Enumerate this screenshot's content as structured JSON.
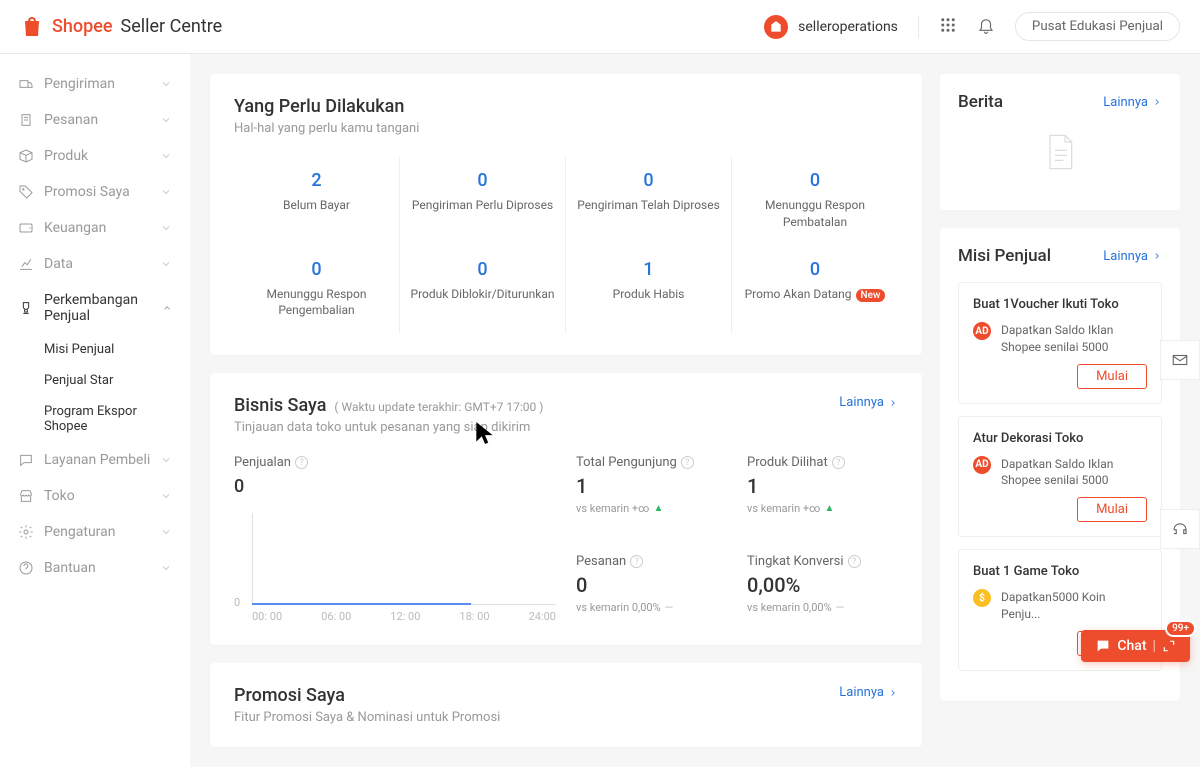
{
  "header": {
    "logo_brand": "Shopee",
    "logo_sub": "Seller Centre",
    "user_name": "selleroperations",
    "edu_button": "Pusat Edukasi Penjual"
  },
  "sidebar": {
    "items": [
      {
        "label": "Pengiriman",
        "icon": "truck"
      },
      {
        "label": "Pesanan",
        "icon": "clipboard"
      },
      {
        "label": "Produk",
        "icon": "box"
      },
      {
        "label": "Promosi Saya",
        "icon": "tag"
      },
      {
        "label": "Keuangan",
        "icon": "wallet"
      },
      {
        "label": "Data",
        "icon": "chart"
      },
      {
        "label": "Perkembangan Penjual",
        "icon": "trophy",
        "active": true,
        "children": [
          "Misi Penjual",
          "Penjual Star",
          "Program Ekspor Shopee"
        ]
      },
      {
        "label": "Layanan Pembeli",
        "icon": "chat"
      },
      {
        "label": "Toko",
        "icon": "store"
      },
      {
        "label": "Pengaturan",
        "icon": "gear"
      },
      {
        "label": "Bantuan",
        "icon": "help"
      }
    ]
  },
  "todo": {
    "title": "Yang Perlu Dilakukan",
    "subtitle": "Hal-hal yang perlu kamu tangani",
    "items": [
      {
        "value": "2",
        "label": "Belum Bayar"
      },
      {
        "value": "0",
        "label": "Pengiriman Perlu Diproses"
      },
      {
        "value": "0",
        "label": "Pengiriman Telah Diproses"
      },
      {
        "value": "0",
        "label": "Menunggu Respon Pembatalan"
      },
      {
        "value": "0",
        "label": "Menunggu Respon Pengembalian"
      },
      {
        "value": "0",
        "label": "Produk Diblokir/Diturunkan"
      },
      {
        "value": "1",
        "label": "Produk Habis"
      },
      {
        "value": "0",
        "label": "Promo Akan Datang",
        "badge": "New"
      }
    ]
  },
  "business": {
    "title": "Bisnis Saya",
    "meta": "( Waktu update terakhir: GMT+7 17:00 )",
    "subtitle": "Tinjauan data toko untuk pesanan yang siap dikirim",
    "more": "Lainnya",
    "sales_label": "Penjualan",
    "sales_value": "0",
    "chart_x": [
      "00: 00",
      "06: 00",
      "12: 00",
      "18: 00",
      "24:00"
    ],
    "stats": [
      {
        "label": "Total Pengunjung",
        "value": "1",
        "compare": "vs kemarin",
        "delta": "+∞",
        "trend": "up"
      },
      {
        "label": "Produk Dilihat",
        "value": "1",
        "compare": "vs kemarin",
        "delta": "+∞",
        "trend": "up"
      },
      {
        "label": "Pesanan",
        "value": "0",
        "compare": "vs kemarin",
        "delta": "0,00%",
        "trend": "flat"
      },
      {
        "label": "Tingkat Konversi",
        "value": "0,00%",
        "compare": "vs kemarin",
        "delta": "0,00%",
        "trend": "flat"
      }
    ]
  },
  "promo": {
    "title": "Promosi Saya",
    "subtitle": "Fitur Promosi Saya & Nominasi untuk Promosi",
    "more": "Lainnya"
  },
  "news": {
    "title": "Berita",
    "more": "Lainnya"
  },
  "missions": {
    "title": "Misi Penjual",
    "more": "Lainnya",
    "start": "Mulai",
    "items": [
      {
        "title": "Buat 1Voucher Ikuti Toko",
        "desc": "Dapatkan Saldo Iklan Shopee senilai 5000",
        "icon": "ad"
      },
      {
        "title": "Atur Dekorasi Toko",
        "desc": "Dapatkan Saldo Iklan Shopee senilai 5000",
        "icon": "ad"
      },
      {
        "title": "Buat 1 Game Toko",
        "desc": "Dapatkan5000 Koin Penju...",
        "icon": "coin"
      }
    ]
  },
  "chat": {
    "label": "Chat",
    "badge": "99+"
  },
  "chart_data": {
    "type": "line",
    "title": "Penjualan",
    "xlabel": "",
    "ylabel": "",
    "x": [
      "00:00",
      "06:00",
      "12:00",
      "18:00",
      "24:00"
    ],
    "values": [
      0,
      0,
      0,
      0,
      0
    ],
    "ylim": [
      0,
      1
    ]
  }
}
